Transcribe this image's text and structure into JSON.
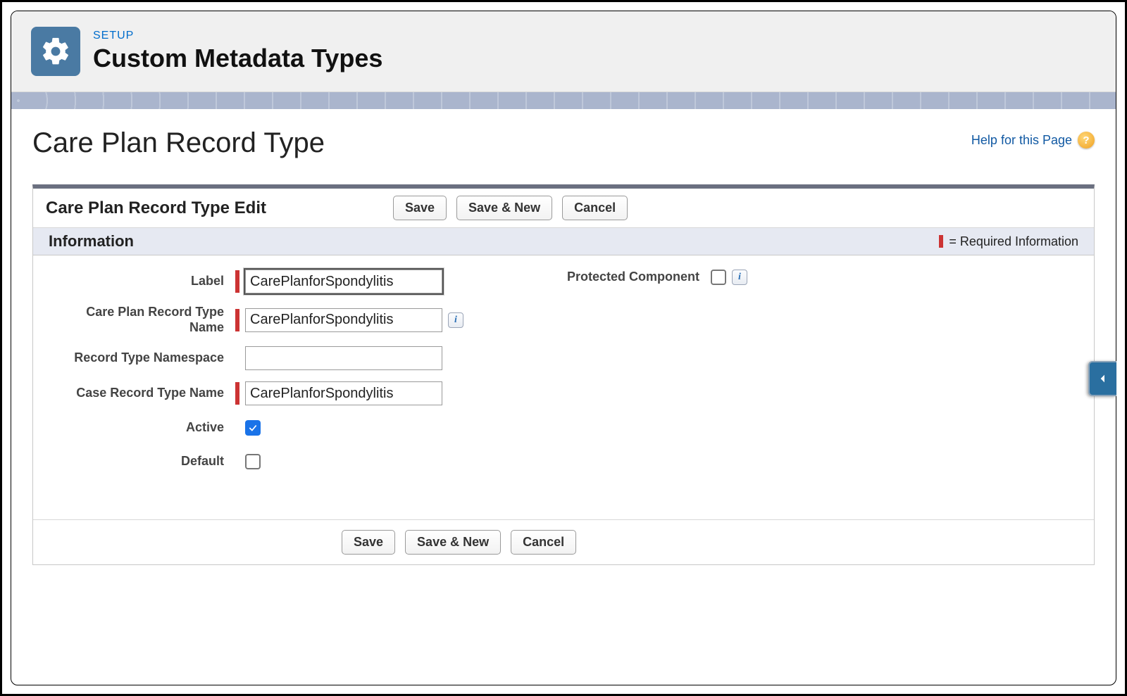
{
  "header": {
    "setup_label": "SETUP",
    "title": "Custom Metadata Types"
  },
  "page": {
    "title": "Care Plan Record Type",
    "help_link_text": "Help for this Page"
  },
  "panel": {
    "edit_title": "Care Plan Record Type Edit",
    "section_title": "Information",
    "required_info_text": "= Required Information"
  },
  "buttons": {
    "save": "Save",
    "save_new": "Save & New",
    "cancel": "Cancel"
  },
  "fields": {
    "label": {
      "label": "Label",
      "value": "CarePlanforSpondylitis",
      "required": true
    },
    "name": {
      "label": "Care Plan Record Type Name",
      "value": "CarePlanforSpondylitis",
      "required": true
    },
    "namespace": {
      "label": "Record Type Namespace",
      "value": "",
      "required": false
    },
    "case_record": {
      "label": "Case Record Type Name",
      "value": "CarePlanforSpondylitis",
      "required": true
    },
    "active": {
      "label": "Active",
      "checked": true
    },
    "default": {
      "label": "Default",
      "checked": false
    },
    "protected": {
      "label": "Protected Component",
      "checked": false
    }
  }
}
